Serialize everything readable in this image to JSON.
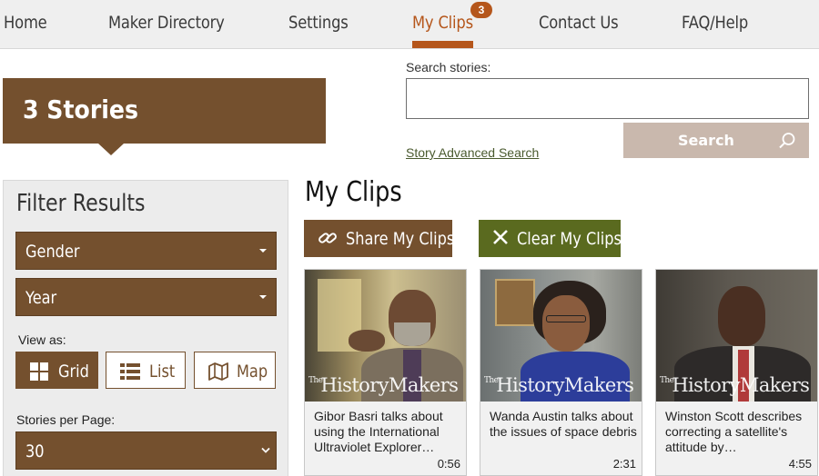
{
  "nav": {
    "items": [
      {
        "label": "Home"
      },
      {
        "label": "Maker Directory"
      },
      {
        "label": "Settings"
      },
      {
        "label": "My Clips",
        "badge": "3"
      },
      {
        "label": "Contact Us"
      },
      {
        "label": "FAQ/Help"
      }
    ],
    "active": "My Clips"
  },
  "banner": {
    "label": "3 Stories"
  },
  "search": {
    "label": "Search stories:",
    "value": "",
    "button_label": "Search",
    "advanced_link": "Story Advanced Search"
  },
  "filter": {
    "title": "Filter Results",
    "gender_label": "Gender",
    "year_label": "Year",
    "view_as_label": "View as:",
    "view_options": [
      {
        "label": "Grid",
        "icon": "grid-icon",
        "active": true
      },
      {
        "label": "List",
        "icon": "list-icon",
        "active": false
      },
      {
        "label": "Map",
        "icon": "map-icon",
        "active": false
      }
    ],
    "per_page_label": "Stories per Page:",
    "per_page_value": "30"
  },
  "clips": {
    "title": "My Clips",
    "share_label": "Share My Clips",
    "clear_label": "Clear My Clips",
    "watermark": "HistoryMakers",
    "watermark_prefix": "The",
    "items": [
      {
        "caption": "Gibor Basri talks about using the International Ultraviolet Explorer…",
        "duration": "0:56"
      },
      {
        "caption": "Wanda Austin talks about the issues of space debris",
        "duration": "2:31"
      },
      {
        "caption": "Winston Scott describes correcting a satellite's attitude by…",
        "duration": "4:55"
      }
    ]
  },
  "colors": {
    "brown": "#74502e",
    "accent_orange": "#b5561b",
    "olive": "#5a6a1f",
    "search_button": "#c9b8ad"
  }
}
